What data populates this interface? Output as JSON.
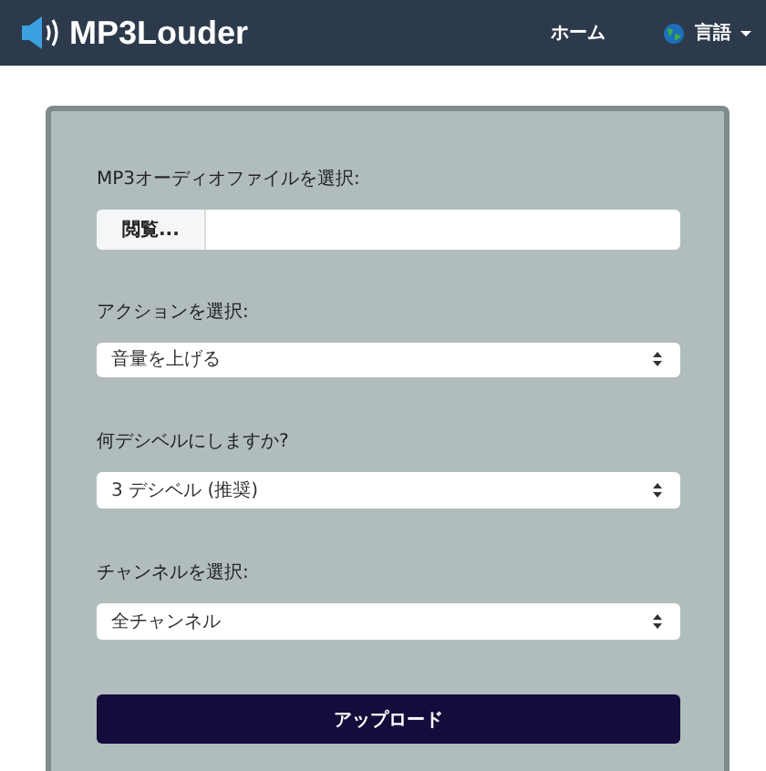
{
  "navbar": {
    "brand": "MP3Louder",
    "links": [
      {
        "label": "ホーム"
      },
      {
        "label": "言語"
      }
    ]
  },
  "form": {
    "file_label": "MP3オーディオファイルを選択:",
    "browse_button": "閲覧...",
    "selects": [
      {
        "label": "アクションを選択:",
        "value": "音量を上げる"
      },
      {
        "label": "何デシベルにしますか?",
        "value": "3 デシベル (推奨)"
      },
      {
        "label": "チャンネルを選択:",
        "value": "全チャンネル"
      }
    ],
    "submit": "アップロード"
  }
}
